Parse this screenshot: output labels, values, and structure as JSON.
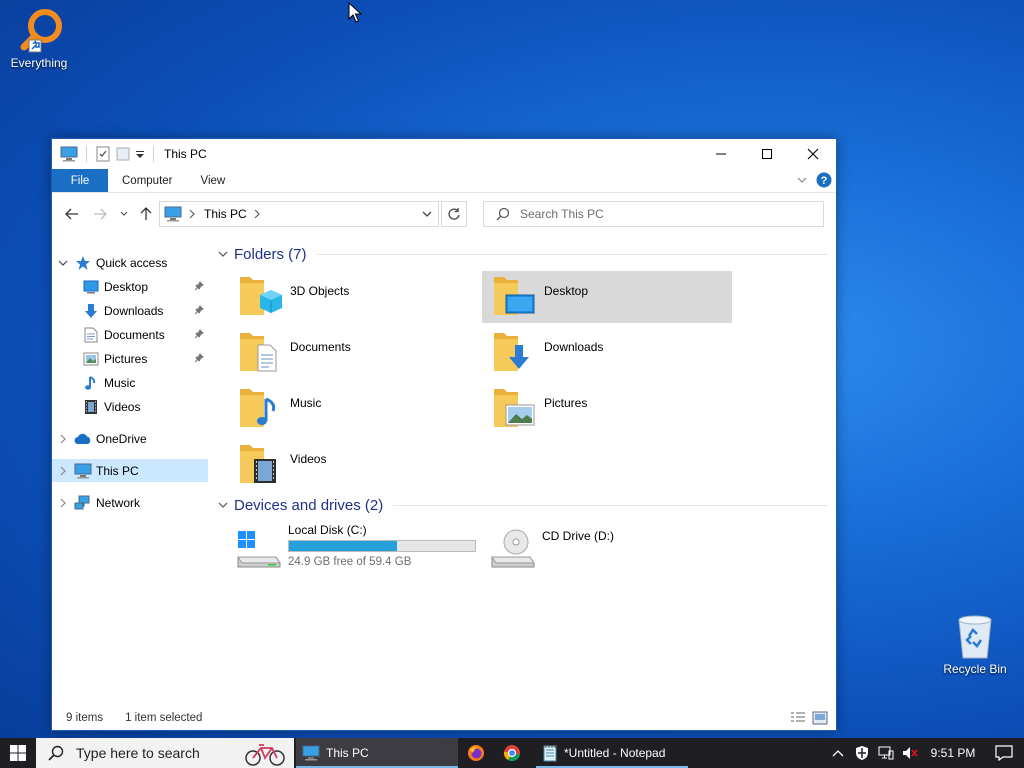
{
  "desktop": {
    "everything_label": "Everything",
    "recycle_label": "Recycle Bin"
  },
  "window": {
    "title": "This PC",
    "ribbon_tabs": [
      "File",
      "Computer",
      "View"
    ]
  },
  "address": {
    "crumb": "This PC",
    "search_placeholder": "Search This PC"
  },
  "nav": {
    "quick_access": "Quick access",
    "quick_items": [
      {
        "label": "Desktop",
        "pinned": true
      },
      {
        "label": "Downloads",
        "pinned": true
      },
      {
        "label": "Documents",
        "pinned": true
      },
      {
        "label": "Pictures",
        "pinned": true
      },
      {
        "label": "Music",
        "pinned": false
      },
      {
        "label": "Videos",
        "pinned": false
      }
    ],
    "onedrive": "OneDrive",
    "this_pc": "This PC",
    "network": "Network"
  },
  "content": {
    "folders_header": "Folders (7)",
    "folders": [
      "3D Objects",
      "Desktop",
      "Documents",
      "Downloads",
      "Music",
      "Pictures",
      "Videos"
    ],
    "selected_folder": "Desktop",
    "drives_header": "Devices and drives (2)",
    "drives": [
      {
        "label": "Local Disk (C:)",
        "free": "24.9 GB free of 59.4 GB",
        "used_fraction": 0.58
      },
      {
        "label": "CD Drive (D:)"
      }
    ]
  },
  "status": {
    "count": "9 items",
    "selection": "1 item selected"
  },
  "taskbar": {
    "search_placeholder": "Type here to search",
    "explorer_label": "This PC",
    "notepad_label": "*Untitled - Notepad",
    "clock": "9:51 PM"
  },
  "colors": {
    "accent": "#1a6fc5",
    "selection": "#cce8ff",
    "drive_bar": "#26a0da",
    "folder": "#f5c34f"
  }
}
